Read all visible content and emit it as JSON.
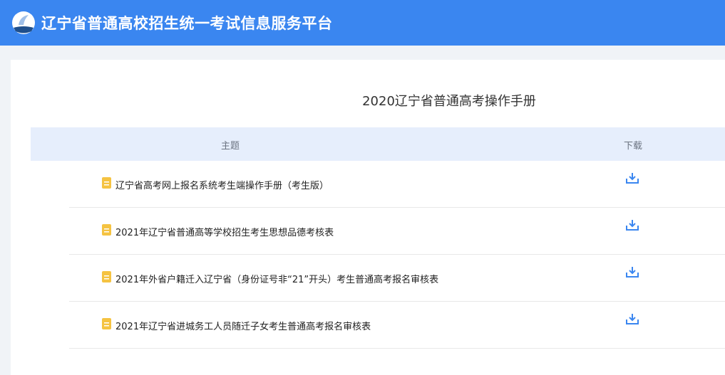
{
  "header": {
    "title": "辽宁省普通高校招生统一考试信息服务平台",
    "logo_icon": "logo-icon"
  },
  "page": {
    "title": "2020辽宁省普通高考操作手册"
  },
  "table": {
    "columns": [
      "主题",
      "下载"
    ],
    "rows": [
      {
        "title": "辽宁省高考网上报名系统考生端操作手册（考生版）",
        "icon": "file-icon",
        "action_icon": "download-icon"
      },
      {
        "title": "2021年辽宁省普通高等学校招生考生思想品德考核表",
        "icon": "file-icon",
        "action_icon": "download-icon"
      },
      {
        "title": "2021年外省户籍迁入辽宁省（身份证号非“21”开头）考生普通高考报名审核表",
        "icon": "file-icon",
        "action_icon": "download-icon"
      },
      {
        "title": "2021年辽宁省进城务工人员随迁子女考生普通高考报名审核表",
        "icon": "file-icon",
        "action_icon": "download-icon"
      }
    ]
  },
  "colors": {
    "header": "#3a86f0",
    "table_header": "#e6eefc",
    "file_icon": "#f5c342",
    "download_icon": "#3a86f0"
  }
}
